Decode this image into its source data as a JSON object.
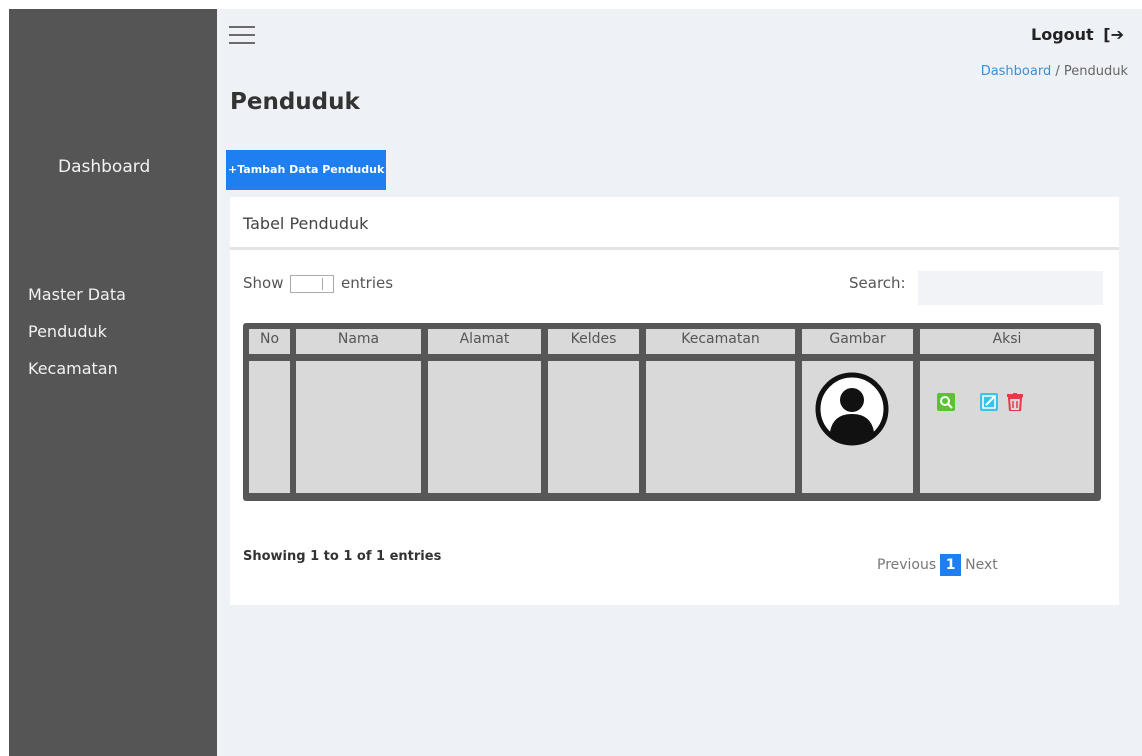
{
  "sidebar": {
    "dashboard": "Dashboard",
    "items": [
      "Master Data",
      "Penduduk",
      "Kecamatan"
    ]
  },
  "header": {
    "logout": "Logout",
    "logout_icon": "sign-out-icon",
    "breadcrumb": {
      "home": "Dashboard",
      "separator": " / ",
      "current": "Penduduk"
    }
  },
  "page": {
    "title": "Penduduk",
    "add_button": "+Tambah Data Penduduk"
  },
  "card": {
    "title": "Tabel Penduduk",
    "show_label": "Show",
    "entries_label": "entries",
    "search_label": "Search:",
    "search_value": "",
    "table": {
      "columns": [
        "No",
        "Nama",
        "Alamat",
        "Keldes",
        "Kecamatan",
        "Gambar",
        "Aksi"
      ],
      "rows": [
        {
          "no": "",
          "nama": "",
          "alamat": "",
          "keldes": "",
          "kecamatan": "",
          "gambar": "user-avatar-icon",
          "aksi": [
            "view-icon",
            "edit-icon",
            "delete-icon"
          ]
        }
      ]
    },
    "showing": "Showing 1 to 1 of 1 entries",
    "pagination": {
      "previous": "Previous",
      "current": "1",
      "next": "Next"
    }
  },
  "colors": {
    "sidebar": "#555555",
    "primary": "#1f7ef0",
    "view_icon": "#5bc236",
    "edit_icon": "#3cc2e8",
    "delete_icon": "#e8394a"
  }
}
